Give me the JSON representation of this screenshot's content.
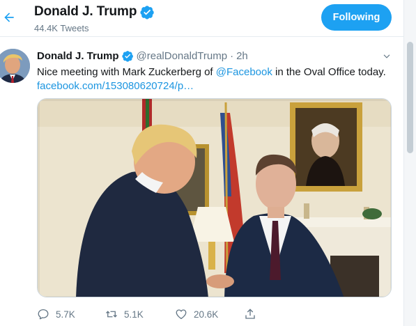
{
  "header": {
    "name": "Donald J. Trump",
    "tweet_count": "44.4K Tweets",
    "follow_label": "Following"
  },
  "tweet": {
    "author": "Donald J. Trump",
    "handle": "@realDonaldTrump",
    "separator": "·",
    "time": "2h",
    "text_before": "Nice meeting with Mark Zuckerberg of ",
    "mention": "@Facebook",
    "text_after": " in the Oval Office today.",
    "link": "facebook.com/153080620724/p…",
    "counts": {
      "replies": "5.7K",
      "retweets": "5.1K",
      "likes": "20.6K"
    }
  },
  "colors": {
    "accent": "#1da1f2",
    "link": "#1b95e0",
    "muted": "#657786",
    "verified": "#1da1f2"
  },
  "icons": [
    "back-arrow-icon",
    "verified-badge-icon",
    "chevron-down-icon",
    "reply-icon",
    "retweet-icon",
    "like-icon",
    "share-icon"
  ]
}
